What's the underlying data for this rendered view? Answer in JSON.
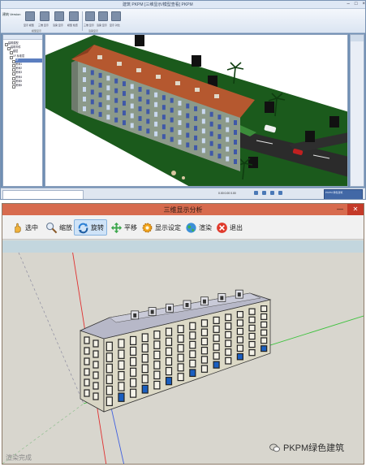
{
  "top_app": {
    "window_title": "建筑 PKPM [三维显示/模型查看] PKPM",
    "app_name": "建筑 Version",
    "ribbon_buttons": [
      {
        "label": "显示 模型"
      },
      {
        "label": "三维 显示"
      },
      {
        "label": "渲染 显示"
      },
      {
        "label": "模型 检查"
      },
      {
        "label": "三维 显示"
      },
      {
        "label": "渲染 显示"
      },
      {
        "label": "显示 对比"
      }
    ],
    "ribbon_group_labels": [
      "模型显示",
      "渲染显示"
    ],
    "tree_nodes": [
      "建筑模型",
      "建筑构件",
      "楼层",
      "1F 标准层",
      "2F",
      "房间1",
      "房间2",
      "房间3",
      "房间4",
      "房间5",
      "房间6"
    ],
    "coordinate_readout": "0.00 0.00 0.00",
    "badge_text": "PKPM 绿色建筑"
  },
  "dialog": {
    "title": "三维显示分析",
    "buttons": [
      {
        "label": "选中",
        "icon": "select-hand-icon"
      },
      {
        "label": "缩放",
        "icon": "zoom-icon"
      },
      {
        "label": "旋转",
        "icon": "rotate-icon",
        "active": true
      },
      {
        "label": "平移",
        "icon": "pan-icon"
      },
      {
        "label": "显示设定",
        "icon": "settings-gear-icon"
      },
      {
        "label": "渲染",
        "icon": "render-globe-icon"
      },
      {
        "label": "退出",
        "icon": "exit-icon"
      }
    ],
    "status_text": "渲染完成",
    "window_controls": [
      "—",
      "✕"
    ]
  },
  "watermark": {
    "text": "PKPM绿色建筑"
  },
  "colors": {
    "dialog_titlebar": "#d76b4e",
    "viewport_background": "#d8d6ce",
    "grass": "#1b5a1c",
    "roof_top": "#b5582f",
    "axis_red": "#e03030",
    "axis_green": "#3cc23c",
    "axis_blue": "#4060e0"
  }
}
